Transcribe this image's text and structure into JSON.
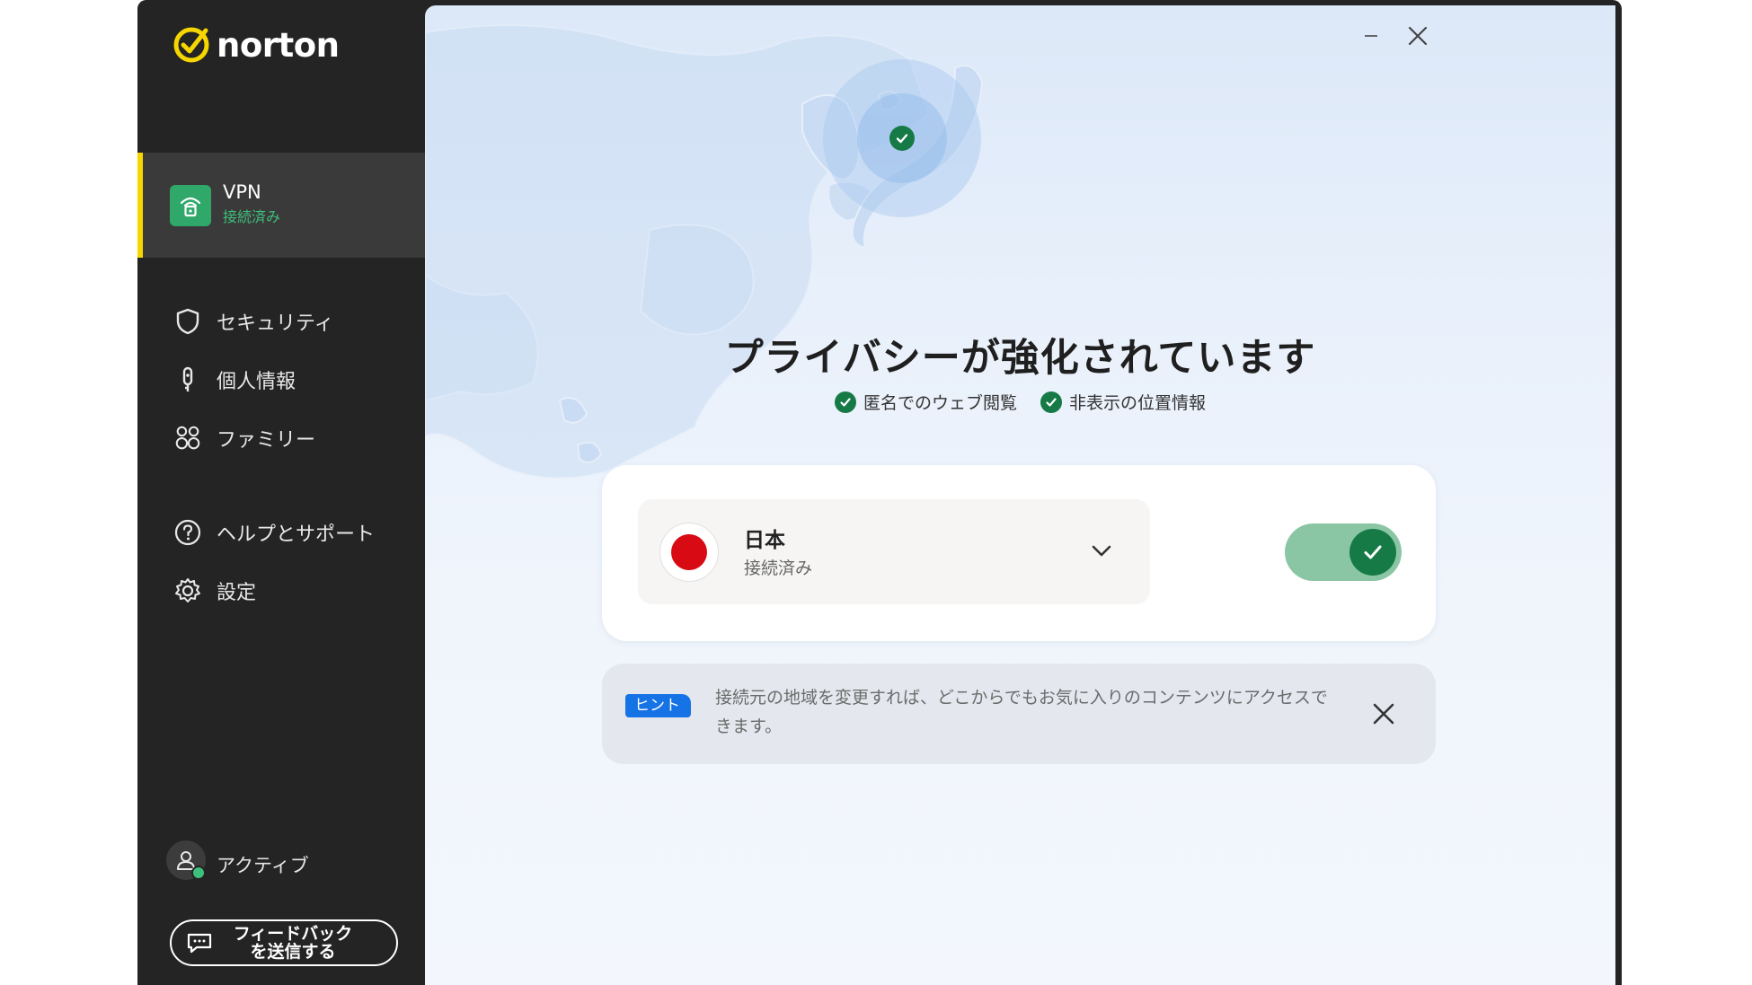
{
  "app": {
    "brand": "norton"
  },
  "sidebar": {
    "vpn": {
      "label": "VPN",
      "status": "接続済み"
    },
    "items": [
      {
        "label": "セキュリティ",
        "icon": "shield-icon"
      },
      {
        "label": "個人情報",
        "icon": "identity-icon"
      },
      {
        "label": "ファミリー",
        "icon": "family-icon"
      },
      {
        "label": "ヘルプとサポート",
        "icon": "help-icon"
      },
      {
        "label": "設定",
        "icon": "gear-icon"
      }
    ],
    "account": {
      "label": "アクティブ"
    },
    "feedback": {
      "line1": "フィードバック",
      "line2": "を送信する"
    }
  },
  "main": {
    "headline": "プライバシーが強化されています",
    "features": [
      "匿名でのウェブ閲覧",
      "非表示の位置情報"
    ],
    "connection": {
      "country": "日本",
      "status": "接続済み",
      "connected": true
    },
    "hint": {
      "badge": "ヒント",
      "text": "接続元の地域を変更すれば、どこからでもお気に入りのコンテンツにアクセスできます。"
    }
  },
  "colors": {
    "accent_yellow": "#f6d600",
    "connected_green": "#157a46",
    "toggle_track": "#8bc6a4",
    "hint_blue": "#1673e6",
    "flag_red": "#d80a14"
  }
}
